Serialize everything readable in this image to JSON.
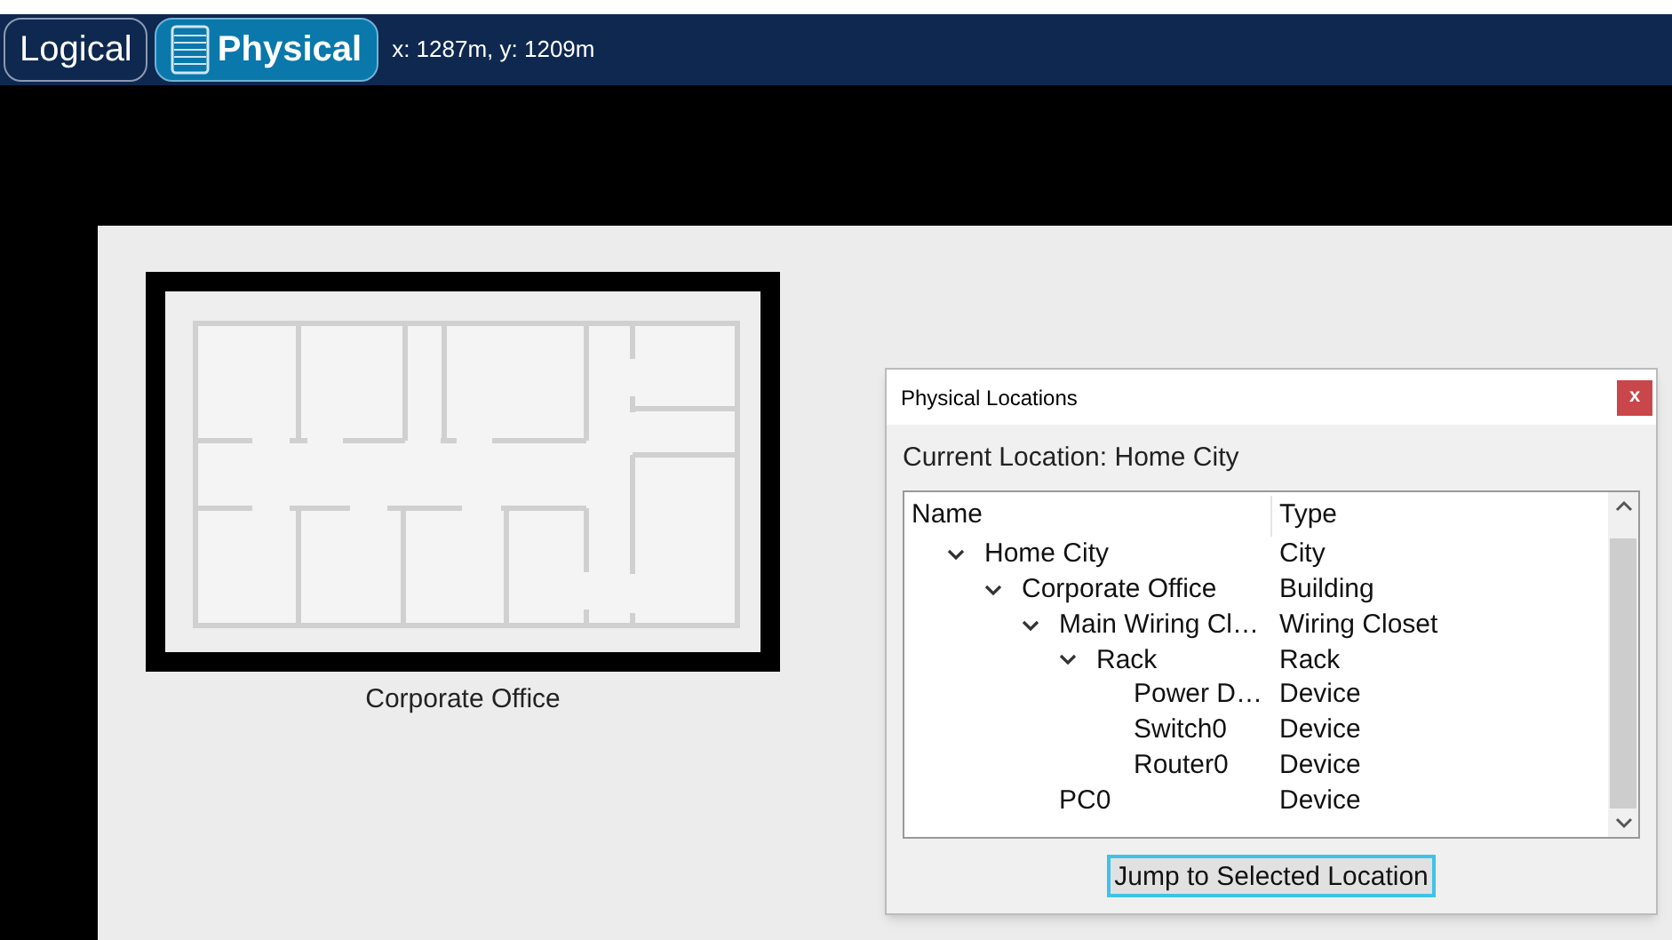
{
  "toolbar": {
    "tabs": [
      {
        "label": "Logical",
        "selected": false
      },
      {
        "label": "Physical",
        "selected": true
      }
    ],
    "coordinates": "x: 1287m, y: 1209m"
  },
  "canvas": {
    "building": {
      "label": "Corporate Office"
    }
  },
  "dialog": {
    "title": "Physical Locations",
    "close": "x",
    "current_location": "Current Location: Home City",
    "tree": {
      "columns": [
        "Name",
        "Type"
      ],
      "rows": [
        {
          "name": "Home City",
          "type": "City",
          "expanded": true,
          "children": [
            {
              "name": "Corporate Office",
              "type": "Building",
              "expanded": true,
              "children": [
                {
                  "name": "Main Wiring Cl…",
                  "type": "Wiring Closet",
                  "expanded": true,
                  "children": [
                    {
                      "name": "Rack",
                      "type": "Rack",
                      "expanded": true,
                      "children": [
                        {
                          "name": "Power D…",
                          "type": "Device"
                        },
                        {
                          "name": "Switch0",
                          "type": "Device"
                        },
                        {
                          "name": "Router0",
                          "type": "Device"
                        }
                      ]
                    }
                  ]
                },
                {
                  "name": "PC0",
                  "type": "Device"
                }
              ]
            }
          ]
        }
      ]
    },
    "button": "Jump to Selected Location"
  }
}
